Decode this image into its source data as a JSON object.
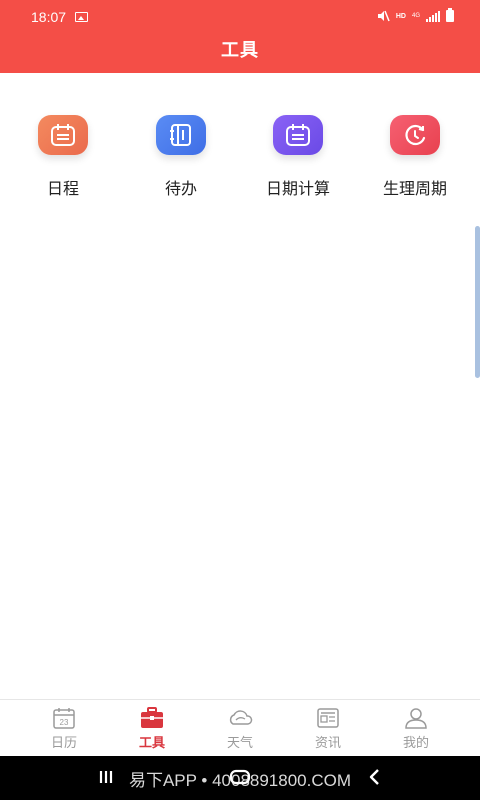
{
  "status_bar": {
    "time": "18:07",
    "hd": "HD",
    "network": "4G"
  },
  "header": {
    "title": "工具"
  },
  "tools": [
    {
      "label": "日程",
      "icon": "calendar-icon",
      "color": "#ef7a55"
    },
    {
      "label": "待办",
      "icon": "notebook-icon",
      "color": "#4b7ef0"
    },
    {
      "label": "日期计算",
      "icon": "calendar-calc-icon",
      "color": "#7a5af3"
    },
    {
      "label": "生理周期",
      "icon": "clock-cycle-icon",
      "color": "#f04e62"
    }
  ],
  "tabbar": {
    "items": [
      {
        "label": "日历",
        "icon": "calendar-tab-icon",
        "day": "23",
        "active": false
      },
      {
        "label": "工具",
        "icon": "toolbox-tab-icon",
        "active": true
      },
      {
        "label": "天气",
        "icon": "weather-tab-icon",
        "active": false
      },
      {
        "label": "资讯",
        "icon": "news-tab-icon",
        "active": false
      },
      {
        "label": "我的",
        "icon": "profile-tab-icon",
        "active": false
      }
    ],
    "active_color": "#d9363e"
  },
  "system_nav": {
    "watermark": "易下APP • 4008891800.COM"
  },
  "colors": {
    "header": "#f44e47"
  }
}
